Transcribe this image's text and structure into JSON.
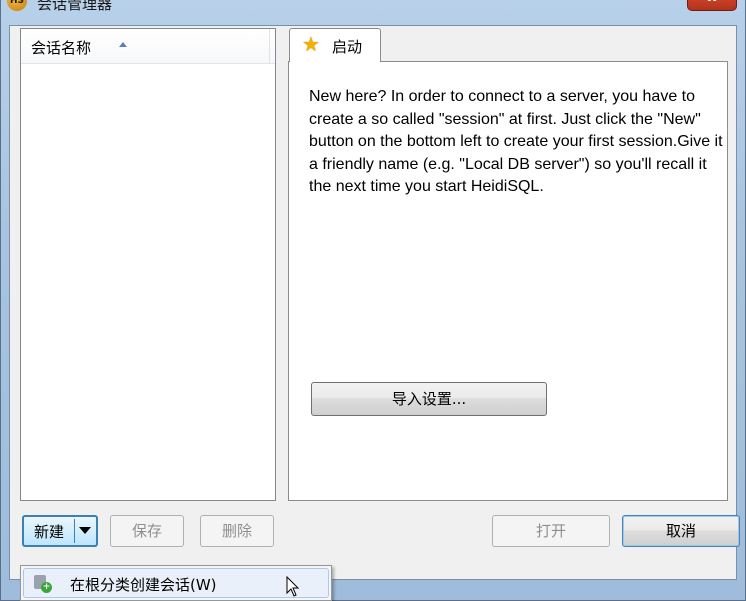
{
  "window": {
    "title": "会话管理器",
    "app_icon_text": "HS",
    "close_label": "x"
  },
  "session_list": {
    "column_header": "会话名称",
    "sort_icon": "sort-ascending-icon"
  },
  "tabs": [
    {
      "label": "启动",
      "icon": "star-icon"
    }
  ],
  "start_tab": {
    "intro_text": "New here? In order to connect to a server, you have to create a so called \"session\" at first. Just click the \"New\" button on the bottom left to create your first session.Give it a friendly name (e.g. \"Local DB server\") so you'll recall it the next time you start HeidiSQL.",
    "import_button": "导入设置..."
  },
  "buttons": {
    "new": "新建",
    "save": "保存",
    "delete": "删除",
    "open": "打开",
    "cancel": "取消"
  },
  "dropdown_menu": {
    "items": [
      {
        "label": "在根分类创建会话(W)",
        "icon": "new-session-icon"
      }
    ]
  },
  "colors": {
    "accent": "#3c7fb1",
    "star": "#f2b200",
    "close": "#c8412a"
  }
}
